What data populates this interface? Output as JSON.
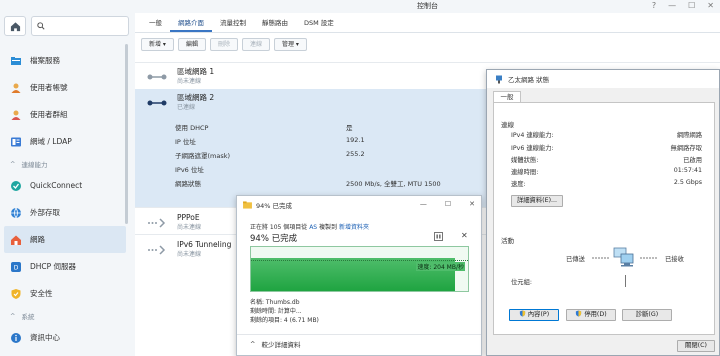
{
  "control_panel": {
    "title": "控制台",
    "tabs": [
      {
        "label": "一般"
      },
      {
        "label": "網路介面"
      },
      {
        "label": "流量控制"
      },
      {
        "label": "靜態路由"
      },
      {
        "label": "DSM 設定"
      }
    ],
    "toolbar": {
      "create": "新增",
      "edit": "編輯",
      "delete": "刪除",
      "connect": "連線",
      "manage": "管理"
    },
    "sidebar": {
      "items_top": [
        {
          "label": "檔案服務",
          "icon": "folder-icon"
        },
        {
          "label": "使用者帳號",
          "icon": "user-icon"
        },
        {
          "label": "使用者群組",
          "icon": "group-icon"
        },
        {
          "label": "網域 / LDAP",
          "icon": "domain-icon"
        }
      ],
      "section_connectivity": "連線能力",
      "items_mid": [
        {
          "label": "QuickConnect",
          "icon": "quickconnect-icon"
        },
        {
          "label": "外部存取",
          "icon": "globe-icon"
        },
        {
          "label": "網路",
          "icon": "network-home-icon"
        },
        {
          "label": "DHCP 伺服器",
          "icon": "dhcp-icon"
        },
        {
          "label": "安全性",
          "icon": "shield-icon"
        }
      ],
      "section_system": "系統",
      "items_bottom": [
        {
          "label": "資訊中心",
          "icon": "info-icon"
        }
      ]
    },
    "interfaces": [
      {
        "name": "區域網路 1",
        "status": "尚未連線"
      },
      {
        "name": "區域網路 2",
        "status": "已連線"
      },
      {
        "name": "PPPoE",
        "status": "尚未連線"
      },
      {
        "name": "IPv6 Tunneling",
        "status": "尚未連線"
      }
    ],
    "lan2_details": [
      {
        "key": "使用 DHCP",
        "value": "是"
      },
      {
        "key": "IP 位址",
        "value": "192.1"
      },
      {
        "key": "子網路遮罩(mask)",
        "value": "255.2"
      },
      {
        "key": "IPv6 位址",
        "value": ""
      },
      {
        "key": "網路狀態",
        "value": "2500 Mb/s, 全雙工, MTU 1500"
      }
    ]
  },
  "copy_dialog": {
    "title": "94% 已完成",
    "line_prefix": "正在將 105 個項目從 ",
    "source": "AS",
    "line_mid": " 複製到 ",
    "dest": "新增資料夾",
    "percent_text": "94% 已完成",
    "speed": "速度: 204 MB/秒",
    "progress": 0.94,
    "name_line": "名稱: Thumbs.db",
    "time_line": "剩餘時間: 計算中...",
    "items_line": "剩餘的項目: 4 (6.71 MB)",
    "less_details": "較少詳細資料"
  },
  "eth_dialog": {
    "title": "乙太網路 狀態",
    "tab": "一般",
    "connection_title": "連線",
    "rows": [
      {
        "key": "IPv4 連線能力:",
        "value": "網際網路"
      },
      {
        "key": "IPv6 連線能力:",
        "value": "無網路存取"
      },
      {
        "key": "媒體狀態:",
        "value": "已啟用"
      },
      {
        "key": "連線時間:",
        "value": "01:57:41"
      },
      {
        "key": "速度:",
        "value": "2.5 Gbps"
      }
    ],
    "details_button": "詳細資料(E)...",
    "activity_title": "活動",
    "sent_label": "已傳送",
    "received_label": "已接收",
    "bytes_label": "位元組:",
    "properties_button": "內容(P)",
    "disable_button": "停用(D)",
    "diagnose_button": "診斷(G)",
    "close_button": "關閉(C)"
  }
}
